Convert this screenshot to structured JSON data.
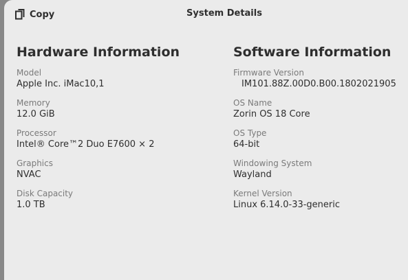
{
  "header": {
    "copy_label": "Copy",
    "title": "System Details",
    "copy_icon": "copy-icon"
  },
  "hardware": {
    "title": "Hardware Information",
    "rows": [
      {
        "label": "Model",
        "value": "Apple Inc. iMac10,1"
      },
      {
        "label": "Memory",
        "value": "12.0 GiB"
      },
      {
        "label": "Processor",
        "value": "Intel® Core™2 Duo E7600 × 2"
      },
      {
        "label": "Graphics",
        "value": "NVAC"
      },
      {
        "label": "Disk Capacity",
        "value": "1.0 TB"
      }
    ]
  },
  "software": {
    "title": "Software Information",
    "rows": [
      {
        "label": "Firmware Version",
        "value": "IM101.88Z.00D0.B00.1802021905"
      },
      {
        "label": "OS Name",
        "value": "Zorin OS 18 Core"
      },
      {
        "label": "OS Type",
        "value": "64-bit"
      },
      {
        "label": "Windowing System",
        "value": "Wayland"
      },
      {
        "label": "Kernel Version",
        "value": "Linux 6.14.0-33-generic"
      }
    ]
  },
  "colors": {
    "window_bg": "#ebebeb",
    "text": "#2e2e2e",
    "label": "#7a7a7a"
  }
}
